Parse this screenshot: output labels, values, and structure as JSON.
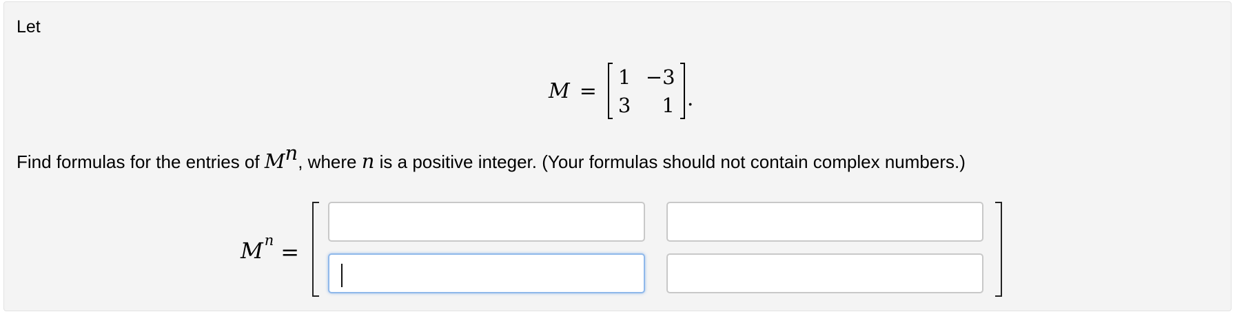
{
  "intro": "Let",
  "matrix_def": {
    "name": "M",
    "equals": "=",
    "rows": [
      [
        "1",
        "−3"
      ],
      [
        "3",
        "1"
      ]
    ],
    "terminator": "."
  },
  "prompt": {
    "text1": "Find formulas for the entries of ",
    "math_base": "M",
    "math_exp": "n",
    "text2": ", where ",
    "math_var": "n",
    "text3": " is a positive integer. (Your formulas should not contain complex numbers.)"
  },
  "answer": {
    "lhs_base": "M",
    "lhs_exp": "n",
    "equals": "=",
    "cells": [
      {
        "value": ""
      },
      {
        "value": ""
      },
      {
        "value": ""
      },
      {
        "value": ""
      }
    ]
  }
}
